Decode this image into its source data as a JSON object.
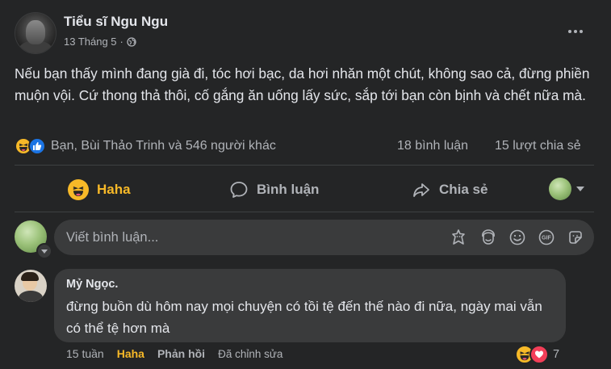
{
  "post": {
    "page_name": "Tiểu sĩ Ngu Ngu",
    "date": "13 Tháng 5",
    "dot": "·",
    "text": "Nếu bạn thấy mình đang già đi, tóc hơi bạc, da hơi nhăn một chút, không sao cả, đừng phiền muộn vội. Cứ thong thả thôi, cố gắng ăn uống lấy sức, sắp tới bạn còn bịnh và chết nữa mà.",
    "reaction_summary": "Bạn, Bùi Thảo Trinh và 546 người khác",
    "comment_count": "18 bình luận",
    "share_count": "15 lượt chia sẻ",
    "reaction_icons": [
      "haha-icon",
      "like-icon"
    ]
  },
  "actions": {
    "haha": "Haha",
    "comment": "Bình luận",
    "share": "Chia sẻ"
  },
  "composer": {
    "placeholder": "Viết bình luận..."
  },
  "comment": {
    "author": "Mỷ Ngọc.",
    "text": "đừng buồn dù hôm nay mọi chuyện có tồi tệ đến thế nào đi nữa, ngày mai vẫn có thể tệ hơn mà",
    "time": "15 tuần",
    "haha": "Haha",
    "reply": "Phản hồi",
    "edited": "Đã chỉnh sửa",
    "reaction_count": "7",
    "reaction_icons": [
      "haha-icon",
      "love-icon"
    ]
  },
  "colors": {
    "background": "#242526",
    "surface": "#3a3b3c",
    "text_primary": "#e4e6eb",
    "text_secondary": "#b0b3b8",
    "haha_yellow": "#f7b928",
    "like_blue": "#1b74e4",
    "love_red": "#f33e58"
  }
}
